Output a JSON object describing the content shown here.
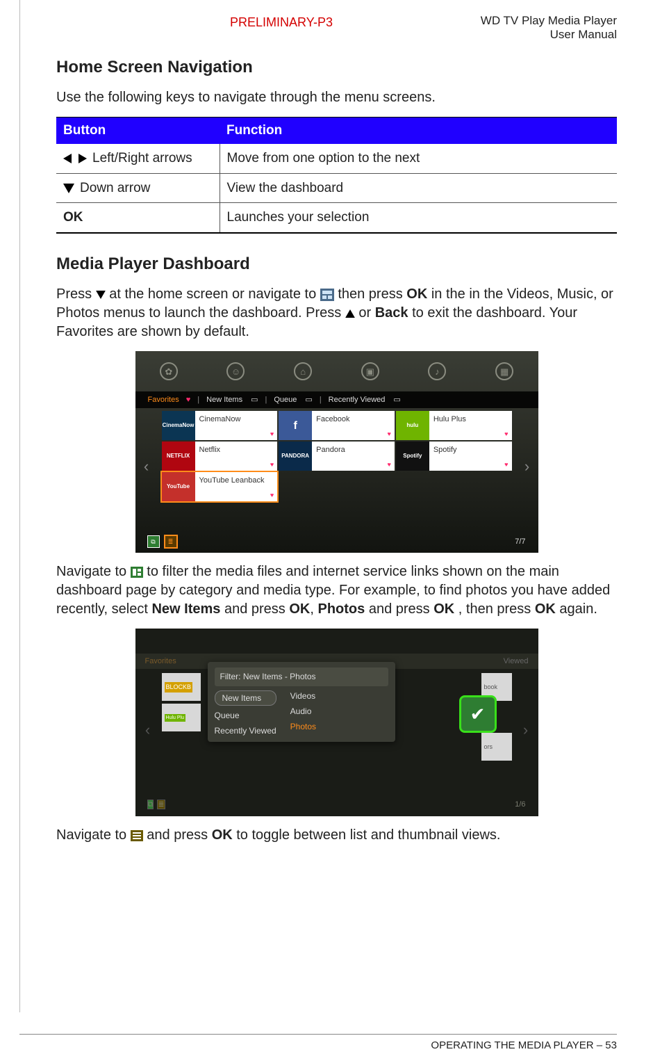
{
  "header": {
    "preliminary": "PRELIMINARY-P3",
    "product_line1": "WD TV Play Media Player",
    "product_line2": "User Manual"
  },
  "sections": {
    "nav_heading": "Home Screen Navigation",
    "nav_intro": "Use the following keys to navigate through the menu screens.",
    "dash_heading": "Media Player Dashboard"
  },
  "nav_table": {
    "headers": {
      "button": "Button",
      "function": "Function"
    },
    "rows": [
      {
        "button": "Left/Right arrows",
        "function": "Move from one option to the next",
        "icon": "lr"
      },
      {
        "button": "Down arrow",
        "function": "View the dashboard",
        "icon": "down"
      },
      {
        "button": "OK",
        "function": "Launches your selection",
        "icon": "ok"
      }
    ]
  },
  "para_dash": {
    "p1a": "Press ",
    "p1b": " at the home screen or navigate to ",
    "p1c": " then press ",
    "p1_ok": "OK",
    "p1d": " in the in the Videos, Music, or Photos menus to launch the dashboard. Press ",
    "p1e": " or ",
    "p1_back": "Back",
    "p1f": " to exit the dashboard. Your Favorites are shown by default.",
    "p2a": "Navigate to ",
    "p2b": " to filter the media files and internet service links shown on the main dashboard page by category and media type. For example, to find photos you have added recently, select ",
    "p2_new": "New Items",
    "p2c": " and press ",
    "p2_ok1": "OK",
    "p2d": ", ",
    "p2_photos": "Photos",
    "p2e": " and press ",
    "p2_ok2": "OK",
    "p2f": ", then press ",
    "p2_ok3": "OK",
    "p2g": " again.",
    "p3a": "Navigate to ",
    "p3b": " and press ",
    "p3_ok": "OK",
    "p3c": " to toggle between list and thumbnail views."
  },
  "dashboard1": {
    "top_icons": [
      "bell",
      "user",
      "gamepad",
      "video",
      "music",
      "photo"
    ],
    "tabs": {
      "favorites": "Favorites",
      "new_items": "New Items",
      "queue": "Queue",
      "recently": "Recently Viewed"
    },
    "tiles": [
      {
        "logo_bg": "#0b3553",
        "logo": "CinemaNow",
        "label": "CinemaNow"
      },
      {
        "logo_bg": "#3b5998",
        "logo": "f",
        "label": "Facebook"
      },
      {
        "logo_bg": "#6fb400",
        "logo": "hulu",
        "label": "Hulu Plus"
      },
      {
        "logo_bg": "#b00610",
        "logo": "NETFLIX",
        "label": "Netflix"
      },
      {
        "logo_bg": "#0a2a4a",
        "logo": "PANDORA",
        "label": "Pandora"
      },
      {
        "logo_bg": "#111",
        "logo": "Spotify",
        "label": "Spotify"
      },
      {
        "logo_bg": "#c4302b",
        "logo": "YouTube",
        "label": "YouTube Leanback",
        "selected": true
      }
    ],
    "counter": "7/7"
  },
  "dashboard2": {
    "favorites_dim": "Favorites",
    "viewed_dim": "Viewed",
    "fade_tiles": [
      "BLOCKB",
      "Hulu Plu",
      "book",
      "ors"
    ],
    "popup": {
      "title": "Filter: New Items - Photos",
      "left": [
        "New Items",
        "Queue",
        "Recently Viewed"
      ],
      "right": [
        "Videos",
        "Audio",
        "Photos"
      ]
    },
    "counter": "1/6"
  },
  "footer": {
    "text": "OPERATING THE MEDIA PLAYER – 53",
    "page": "53"
  }
}
